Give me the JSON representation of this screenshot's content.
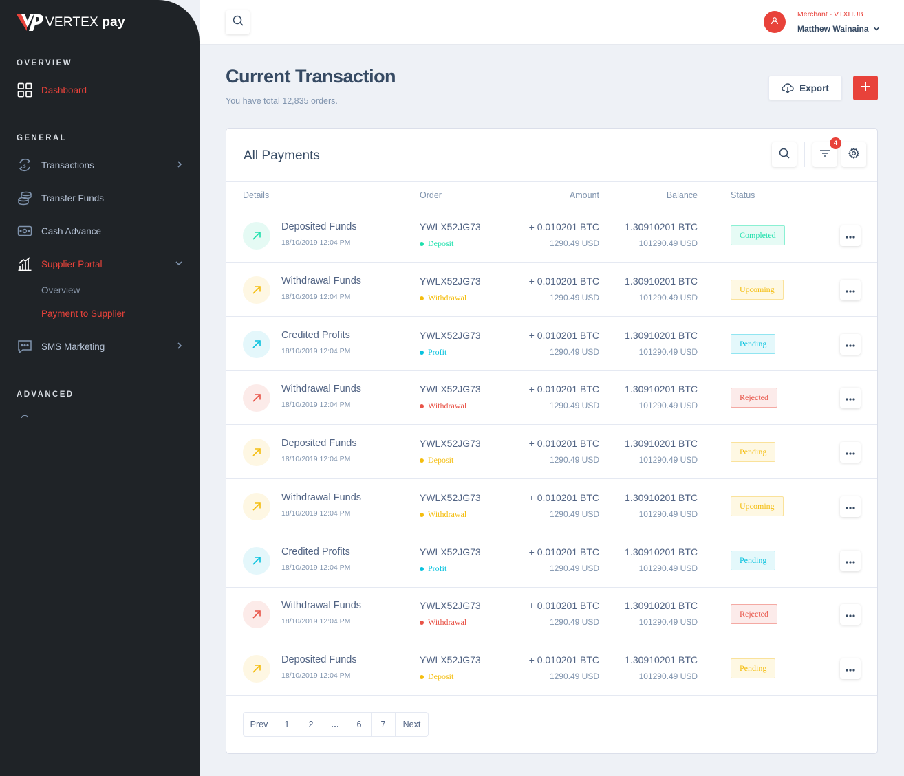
{
  "brand": {
    "name_light": "VERTEX",
    "name_bold": "pay"
  },
  "sidebar": {
    "sections": [
      "OVERVIEW",
      "GENERAL",
      "ADVANCED"
    ],
    "items": [
      {
        "label": "Dashboard",
        "icon": "grid-icon",
        "active": true
      },
      {
        "label": "Transactions",
        "icon": "exchange-icon"
      },
      {
        "label": "Transfer Funds",
        "icon": "coins-icon"
      },
      {
        "label": "Cash Advance",
        "icon": "cash-icon"
      },
      {
        "label": "Supplier Portal",
        "icon": "bar-chart-icon",
        "active": true
      },
      {
        "label": "SMS Marketing",
        "icon": "chat-icon"
      }
    ],
    "sub_items": [
      {
        "label": "Overview"
      },
      {
        "label": "Payment to Supplier",
        "active": true
      }
    ]
  },
  "topbar": {
    "user_role": "Merchant - VTXHUB",
    "user_name": "Matthew Wainaina"
  },
  "header": {
    "title": "Current Transaction",
    "subtitle": "You have total 12,835 orders.",
    "export_label": "Export"
  },
  "card": {
    "title": "All Payments",
    "filter_count": "4",
    "columns": {
      "details": "Details",
      "order": "Order",
      "amount": "Amount",
      "balance": "Balance",
      "status": "Status"
    }
  },
  "rows": [
    {
      "title": "Deposited Funds",
      "date": "18/10/2019 12:04 PM",
      "order": "YWLX52JG73",
      "type": "Deposit",
      "type_color": "#1ee0ac",
      "amount": "+ 0.010201 BTC",
      "amount_usd": "1290.49 USD",
      "balance": "1.30910201 BTC",
      "balance_usd": "101290.49 USD",
      "status": "Completed",
      "tone": "green"
    },
    {
      "title": "Withdrawal Funds",
      "date": "18/10/2019 12:04 PM",
      "order": "YWLX52JG73",
      "type": "Withdrawal",
      "type_color": "#f4bd0e",
      "amount": "+ 0.010201 BTC",
      "amount_usd": "1290.49 USD",
      "balance": "1.30910201 BTC",
      "balance_usd": "101290.49 USD",
      "status": "Upcoming",
      "tone": "yellow"
    },
    {
      "title": "Credited Profits",
      "date": "18/10/2019 12:04 PM",
      "order": "YWLX52JG73",
      "type": "Profit",
      "type_color": "#09c2de",
      "amount": "+ 0.010201 BTC",
      "amount_usd": "1290.49 USD",
      "balance": "1.30910201 BTC",
      "balance_usd": "101290.49 USD",
      "status": "Pending",
      "tone": "cyan"
    },
    {
      "title": "Withdrawal Funds",
      "date": "18/10/2019 12:04 PM",
      "order": "YWLX52JG73",
      "type": "Withdrawal",
      "type_color": "#e85347",
      "amount": "+ 0.010201 BTC",
      "amount_usd": "1290.49 USD",
      "balance": "1.30910201 BTC",
      "balance_usd": "101290.49 USD",
      "status": "Rejected",
      "tone": "red"
    },
    {
      "title": "Deposited Funds",
      "date": "18/10/2019 12:04 PM",
      "order": "YWLX52JG73",
      "type": "Deposit",
      "type_color": "#f4bd0e",
      "amount": "+ 0.010201 BTC",
      "amount_usd": "1290.49 USD",
      "balance": "1.30910201 BTC",
      "balance_usd": "101290.49 USD",
      "status": "Pending",
      "tone": "yellow"
    },
    {
      "title": "Withdrawal Funds",
      "date": "18/10/2019 12:04 PM",
      "order": "YWLX52JG73",
      "type": "Withdrawal",
      "type_color": "#f4bd0e",
      "amount": "+ 0.010201 BTC",
      "amount_usd": "1290.49 USD",
      "balance": "1.30910201 BTC",
      "balance_usd": "101290.49 USD",
      "status": "Upcoming",
      "tone": "yellow"
    },
    {
      "title": "Credited Profits",
      "date": "18/10/2019 12:04 PM",
      "order": "YWLX52JG73",
      "type": "Profit",
      "type_color": "#09c2de",
      "amount": "+ 0.010201 BTC",
      "amount_usd": "1290.49 USD",
      "balance": "1.30910201 BTC",
      "balance_usd": "101290.49 USD",
      "status": "Pending",
      "tone": "cyan"
    },
    {
      "title": "Withdrawal Funds",
      "date": "18/10/2019 12:04 PM",
      "order": "YWLX52JG73",
      "type": "Withdrawal",
      "type_color": "#e85347",
      "amount": "+ 0.010201 BTC",
      "amount_usd": "1290.49 USD",
      "balance": "1.30910201 BTC",
      "balance_usd": "101290.49 USD",
      "status": "Rejected",
      "tone": "red"
    },
    {
      "title": "Deposited Funds",
      "date": "18/10/2019 12:04 PM",
      "order": "YWLX52JG73",
      "type": "Deposit",
      "type_color": "#f4bd0e",
      "amount": "+ 0.010201 BTC",
      "amount_usd": "1290.49 USD",
      "balance": "1.30910201 BTC",
      "balance_usd": "101290.49 USD",
      "status": "Pending",
      "tone": "yellow"
    }
  ],
  "pagination": [
    "Prev",
    "1",
    "2",
    "…",
    "6",
    "7",
    "Next"
  ],
  "tones": {
    "green": {
      "fg": "#1ee0ac",
      "bg": "#e6fbf5",
      "border": "#8af0d3",
      "circle": "#e5faf4"
    },
    "yellow": {
      "fg": "#f4bd0e",
      "bg": "#fef8e3",
      "border": "#fae29b",
      "circle": "#fef7e3"
    },
    "cyan": {
      "fg": "#09c2de",
      "bg": "#e4f8fb",
      "border": "#91e5f1",
      "circle": "#e4f7fb"
    },
    "red": {
      "fg": "#e85347",
      "bg": "#fcebea",
      "border": "#f4a9a3",
      "circle": "#fcebe9"
    }
  }
}
